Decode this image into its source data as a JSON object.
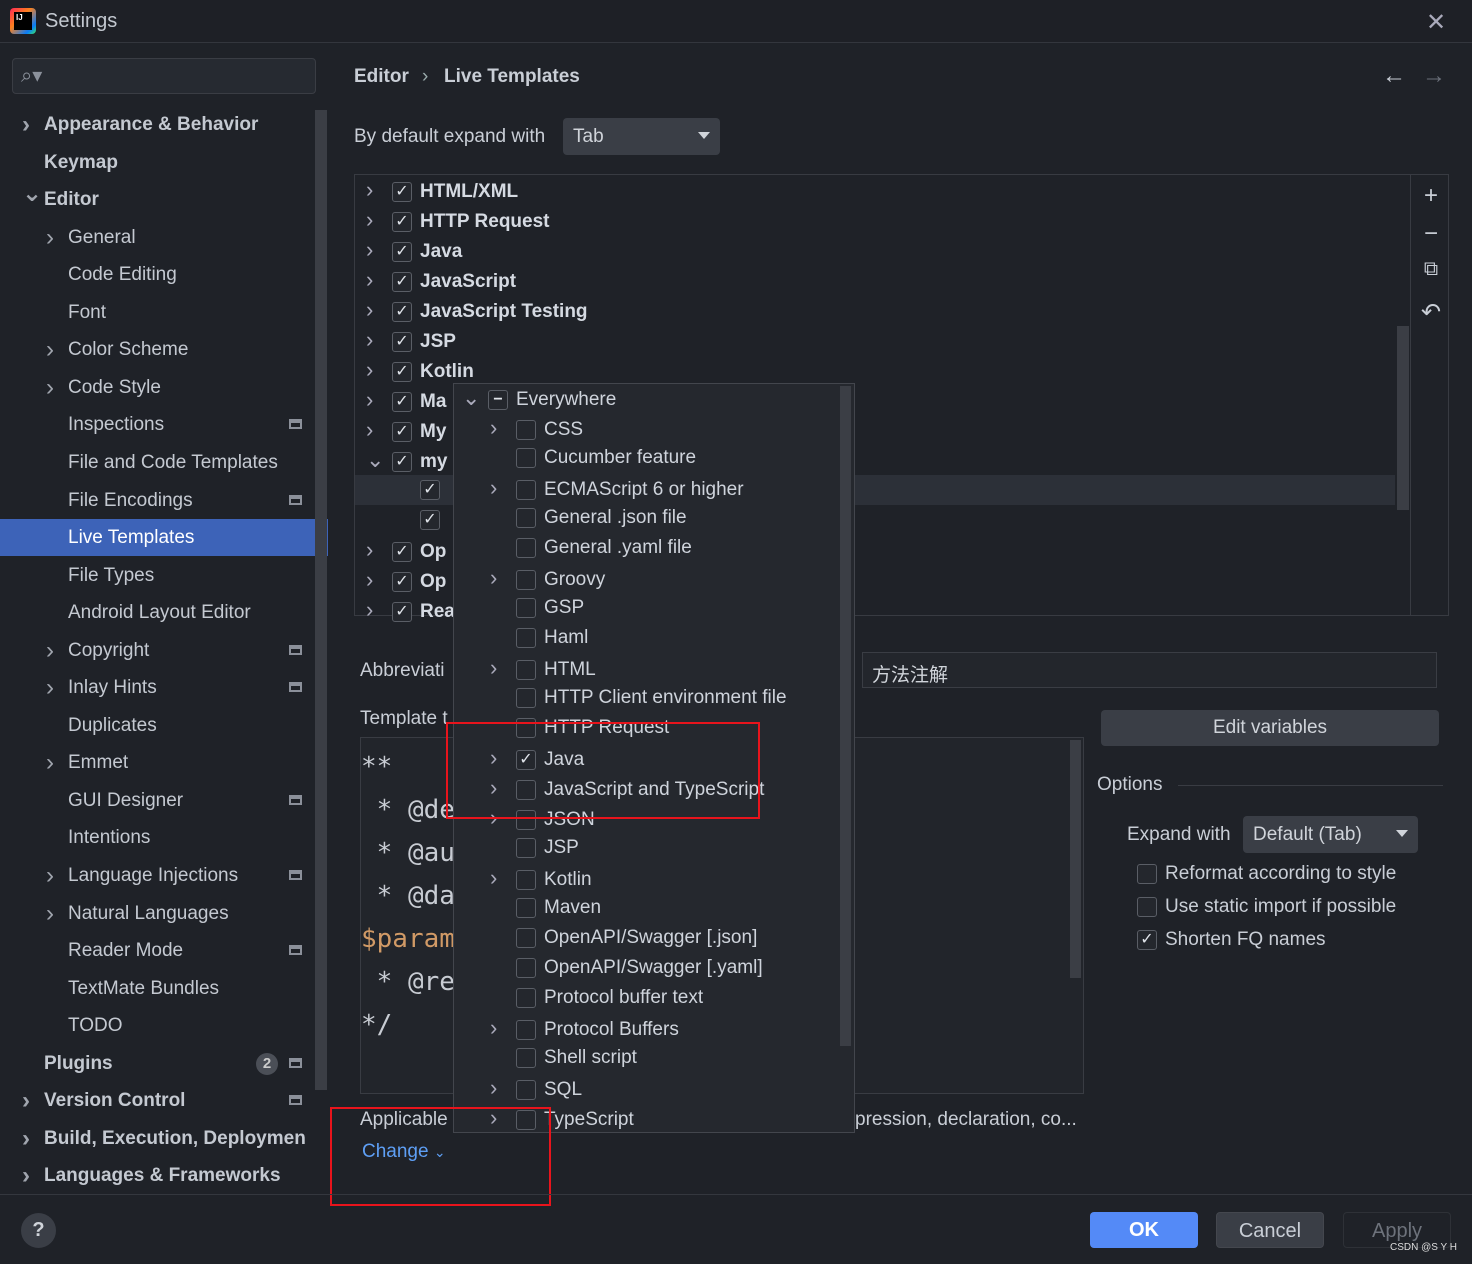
{
  "window": {
    "title": "Settings",
    "close_icon": "close-icon"
  },
  "search": {
    "placeholder": ""
  },
  "sidebar": {
    "items": [
      {
        "label": "Appearance & Behavior",
        "level": 0,
        "chevron": "right",
        "bold": true
      },
      {
        "label": "Keymap",
        "level": 0,
        "bold": true
      },
      {
        "label": "Editor",
        "level": 0,
        "chevron": "down",
        "bold": true
      },
      {
        "label": "General",
        "level": 1,
        "chevron": "right"
      },
      {
        "label": "Code Editing",
        "level": 1
      },
      {
        "label": "Font",
        "level": 1
      },
      {
        "label": "Color Scheme",
        "level": 1,
        "chevron": "right"
      },
      {
        "label": "Code Style",
        "level": 1,
        "chevron": "right"
      },
      {
        "label": "Inspections",
        "level": 1,
        "project": true
      },
      {
        "label": "File and Code Templates",
        "level": 1
      },
      {
        "label": "File Encodings",
        "level": 1,
        "project": true
      },
      {
        "label": "Live Templates",
        "level": 1,
        "selected": true
      },
      {
        "label": "File Types",
        "level": 1
      },
      {
        "label": "Android Layout Editor",
        "level": 1
      },
      {
        "label": "Copyright",
        "level": 1,
        "chevron": "right",
        "project": true
      },
      {
        "label": "Inlay Hints",
        "level": 1,
        "chevron": "right",
        "project": true
      },
      {
        "label": "Duplicates",
        "level": 1
      },
      {
        "label": "Emmet",
        "level": 1,
        "chevron": "right"
      },
      {
        "label": "GUI Designer",
        "level": 1,
        "project": true
      },
      {
        "label": "Intentions",
        "level": 1
      },
      {
        "label": "Language Injections",
        "level": 1,
        "chevron": "right",
        "project": true
      },
      {
        "label": "Natural Languages",
        "level": 1,
        "chevron": "right"
      },
      {
        "label": "Reader Mode",
        "level": 1,
        "project": true
      },
      {
        "label": "TextMate Bundles",
        "level": 1
      },
      {
        "label": "TODO",
        "level": 1
      },
      {
        "label": "Plugins",
        "level": 0,
        "bold": true,
        "badge": "2",
        "project": true
      },
      {
        "label": "Version Control",
        "level": 0,
        "chevron": "right",
        "bold": true,
        "project": true
      },
      {
        "label": "Build, Execution, Deploymen",
        "level": 0,
        "chevron": "right",
        "bold": true
      },
      {
        "label": "Languages & Frameworks",
        "level": 0,
        "chevron": "right",
        "bold": true
      }
    ]
  },
  "breadcrumb": {
    "parent": "Editor",
    "separator": "›",
    "current": "Live Templates"
  },
  "nav": {
    "back": "←",
    "forward": "→"
  },
  "expand_default": {
    "label": "By default expand with",
    "value": "Tab"
  },
  "tree": {
    "items": [
      {
        "label": "HTML/XML",
        "checked": true,
        "chevron": "right",
        "level": 0
      },
      {
        "label": "HTTP Request",
        "checked": true,
        "chevron": "right",
        "level": 0
      },
      {
        "label": "Java",
        "checked": true,
        "chevron": "right",
        "level": 0
      },
      {
        "label": "JavaScript",
        "checked": true,
        "chevron": "right",
        "level": 0
      },
      {
        "label": "JavaScript Testing",
        "checked": true,
        "chevron": "right",
        "level": 0
      },
      {
        "label": "JSP",
        "checked": true,
        "chevron": "right",
        "level": 0
      },
      {
        "label": "Kotlin",
        "checked": true,
        "chevron": "right",
        "level": 0
      },
      {
        "label": "Ma",
        "checked": true,
        "chevron": "right",
        "level": 0
      },
      {
        "label": "My",
        "checked": true,
        "chevron": "right",
        "level": 0
      },
      {
        "label": "my",
        "checked": true,
        "chevron": "down",
        "level": 0
      },
      {
        "label": "",
        "checked": true,
        "level": 1,
        "selected": true
      },
      {
        "label": "",
        "checked": true,
        "level": 1
      },
      {
        "label": "Op",
        "checked": true,
        "chevron": "right",
        "level": 0
      },
      {
        "label": "Op",
        "checked": true,
        "chevron": "right",
        "level": 0
      },
      {
        "label": "Rea",
        "checked": true,
        "chevron": "right",
        "level": 0
      }
    ],
    "toolbar": {
      "add": "+",
      "remove": "−",
      "copy": "⧉",
      "restore": "↶"
    }
  },
  "abbreviation": {
    "label": "Abbreviati",
    "description_value": "方法注解"
  },
  "template_text": {
    "label": "Template t",
    "lines": [
      "**",
      " * @de",
      " * @au",
      " * @da",
      "$param",
      " * @re",
      "*/"
    ]
  },
  "edit_variables": "Edit variables",
  "options": {
    "title": "Options",
    "expand_with_label": "Expand with",
    "expand_with_value": "Default (Tab)",
    "checkboxes": [
      {
        "label": "Reformat according to style",
        "checked": false
      },
      {
        "label": "Use static import if possible",
        "checked": false
      },
      {
        "label": "Shorten FQ names",
        "checked": true
      }
    ]
  },
  "applicable": {
    "label": "Applicable",
    "context_tail": "pression, declaration, co...",
    "change_link": "Change"
  },
  "context_popup": {
    "items": [
      {
        "label": "Everywhere",
        "level": 0,
        "chevron": "down",
        "state": "partial"
      },
      {
        "label": "CSS",
        "level": 1,
        "chevron": "right",
        "state": "unchecked"
      },
      {
        "label": "Cucumber feature",
        "level": 1,
        "state": "unchecked"
      },
      {
        "label": "ECMAScript 6 or higher",
        "level": 1,
        "chevron": "right",
        "state": "unchecked"
      },
      {
        "label": "General .json file",
        "level": 1,
        "state": "unchecked"
      },
      {
        "label": "General .yaml file",
        "level": 1,
        "state": "unchecked"
      },
      {
        "label": "Groovy",
        "level": 1,
        "chevron": "right",
        "state": "unchecked"
      },
      {
        "label": "GSP",
        "level": 1,
        "state": "unchecked"
      },
      {
        "label": "Haml",
        "level": 1,
        "state": "unchecked"
      },
      {
        "label": "HTML",
        "level": 1,
        "chevron": "right",
        "state": "unchecked"
      },
      {
        "label": "HTTP Client environment file",
        "level": 1,
        "state": "unchecked"
      },
      {
        "label": "HTTP Request",
        "level": 1,
        "state": "unchecked"
      },
      {
        "label": "Java",
        "level": 1,
        "chevron": "right",
        "state": "checked"
      },
      {
        "label": "JavaScript and TypeScript",
        "level": 1,
        "chevron": "right",
        "state": "unchecked"
      },
      {
        "label": "JSON",
        "level": 1,
        "chevron": "right",
        "state": "unchecked"
      },
      {
        "label": "JSP",
        "level": 1,
        "state": "unchecked"
      },
      {
        "label": "Kotlin",
        "level": 1,
        "chevron": "right",
        "state": "unchecked"
      },
      {
        "label": "Maven",
        "level": 1,
        "state": "unchecked"
      },
      {
        "label": "OpenAPI/Swagger [.json]",
        "level": 1,
        "state": "unchecked"
      },
      {
        "label": "OpenAPI/Swagger [.yaml]",
        "level": 1,
        "state": "unchecked"
      },
      {
        "label": "Protocol buffer text",
        "level": 1,
        "state": "unchecked"
      },
      {
        "label": "Protocol Buffers",
        "level": 1,
        "chevron": "right",
        "state": "unchecked"
      },
      {
        "label": "Shell script",
        "level": 1,
        "state": "unchecked"
      },
      {
        "label": "SQL",
        "level": 1,
        "chevron": "right",
        "state": "unchecked"
      },
      {
        "label": "TypeScript",
        "level": 1,
        "chevron": "right",
        "state": "unchecked"
      }
    ]
  },
  "footer": {
    "help": "?",
    "ok": "OK",
    "cancel": "Cancel",
    "apply": "Apply"
  },
  "watermark": "CSDN @S Y H",
  "colors": {
    "accent": "#548af7",
    "selection": "#3d63b8",
    "highlight_box": "#e8141c",
    "link": "#5e9ff5",
    "variable": "#d19a66"
  }
}
